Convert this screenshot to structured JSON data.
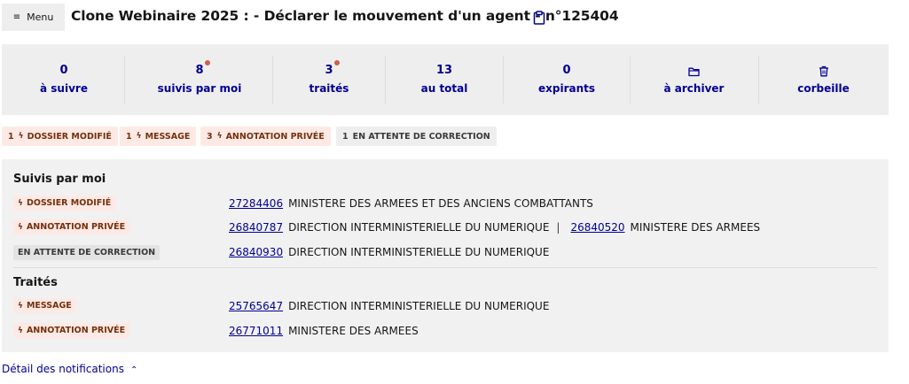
{
  "header": {
    "menu_label": "Menu",
    "menu_icon": "≡",
    "title": "Clone Webinaire 2025 : - Déclarer le mouvement d'un agent - n°125404"
  },
  "stats": [
    {
      "value": "0",
      "label": "à suivre",
      "dot": false
    },
    {
      "value": "8",
      "label": "suivis par moi",
      "dot": true
    },
    {
      "value": "3",
      "label": "traités",
      "dot": true
    },
    {
      "value": "13",
      "label": "au total",
      "dot": false
    },
    {
      "value": "0",
      "label": "expirants",
      "dot": false
    },
    {
      "icon": "folder-icon",
      "label": "à archiver"
    },
    {
      "icon": "trash-icon",
      "label": "corbeille"
    }
  ],
  "badges": [
    {
      "count": "1",
      "label": "DOSSIER MODIFIÉ",
      "variant": "orange"
    },
    {
      "count": "1",
      "label": "MESSAGE",
      "variant": "orange"
    },
    {
      "count": "3",
      "label": "ANNOTATION PRIVÉE",
      "variant": "orange"
    },
    {
      "count": "1",
      "label": "EN ATTENTE DE CORRECTION",
      "variant": "grey"
    }
  ],
  "sections": {
    "suivis": {
      "title": "Suivis par moi",
      "rows": [
        {
          "tag": "DOSSIER MODIFIÉ",
          "variant": "orange",
          "items": [
            {
              "id": "27284406",
              "org": "MINISTERE DES ARMEES ET DES ANCIENS COMBATTANTS"
            }
          ]
        },
        {
          "tag": "ANNOTATION PRIVÉE",
          "variant": "orange",
          "items": [
            {
              "id": "26840787",
              "org": "DIRECTION INTERMINISTERIELLE DU NUMERIQUE"
            },
            {
              "id": "26840520",
              "org": "MINISTERE DES ARMEES"
            }
          ]
        },
        {
          "tag": "EN ATTENTE DE CORRECTION",
          "variant": "grey",
          "items": [
            {
              "id": "26840930",
              "org": "DIRECTION INTERMINISTERIELLE DU NUMERIQUE"
            }
          ]
        }
      ]
    },
    "traites": {
      "title": "Traités",
      "rows": [
        {
          "tag": "MESSAGE",
          "variant": "orange",
          "items": [
            {
              "id": "25765647",
              "org": "DIRECTION INTERMINISTERIELLE DU NUMERIQUE"
            }
          ]
        },
        {
          "tag": "ANNOTATION PRIVÉE",
          "variant": "orange",
          "items": [
            {
              "id": "26771011",
              "org": "MINISTERE DES ARMEES"
            }
          ]
        }
      ]
    },
    "separator": "|"
  },
  "footer": {
    "detail_label": "Détail des notifications",
    "chevron": "⌃"
  },
  "colors": {
    "accent": "#000091",
    "dot": "#ce614a",
    "badge_orange_bg": "#fee9e5",
    "panel_bg": "#eeeeee"
  }
}
